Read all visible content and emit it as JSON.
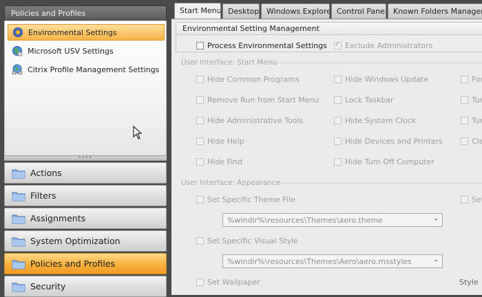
{
  "left": {
    "header": "Policies and Profiles",
    "policies": [
      {
        "label": "Environmental Settings",
        "icon": "gear-globe-icon",
        "selected": true
      },
      {
        "label": "Microsoft USV Settings",
        "icon": "globe-icon",
        "selected": false
      },
      {
        "label": "Citrix Profile Management Settings",
        "icon": "network-globe-icon",
        "selected": false
      }
    ],
    "splitter_grip": "••••",
    "nav": [
      {
        "label": "Actions"
      },
      {
        "label": "Filters"
      },
      {
        "label": "Assignments"
      },
      {
        "label": "System Optimization"
      },
      {
        "label": "Policies and Profiles"
      },
      {
        "label": "Security"
      }
    ]
  },
  "tabs": [
    "Start Menu",
    "Desktop",
    "Windows Explorer",
    "Control Panel",
    "Known Folders Management"
  ],
  "main_group": {
    "title": "Environmental Setting Management",
    "process_label": "Process Environmental Settings",
    "exclude_label": "Exclude Administrators"
  },
  "start_menu": {
    "section": "User Interface: Start Menu",
    "col1": [
      "Hide Common Programs",
      "Remove Run from Start Menu",
      "Hide Administrative Tools",
      "Hide Help",
      "Hide Find"
    ],
    "col2": [
      "Hide Windows Update",
      "Lock Taskbar",
      "Hide System Clock",
      "Hide Devices and Printers",
      "Hide Turn Off Computer"
    ],
    "col3": [
      "For",
      "Tur",
      "Tur",
      "Clea"
    ]
  },
  "appearance": {
    "section": "User Interface: Appearance",
    "theme_label": "Set Specific Theme File",
    "theme_value": "%windir%\\resources\\Themes\\aero.theme",
    "set_right": "Set",
    "visual_label": "Set Specific Visual Style",
    "visual_value": "%windir%\\resources\\Themes\\Aero\\aero.msstyles",
    "wallpaper_label": "Set Wallpaper",
    "style_label": "Style"
  }
}
